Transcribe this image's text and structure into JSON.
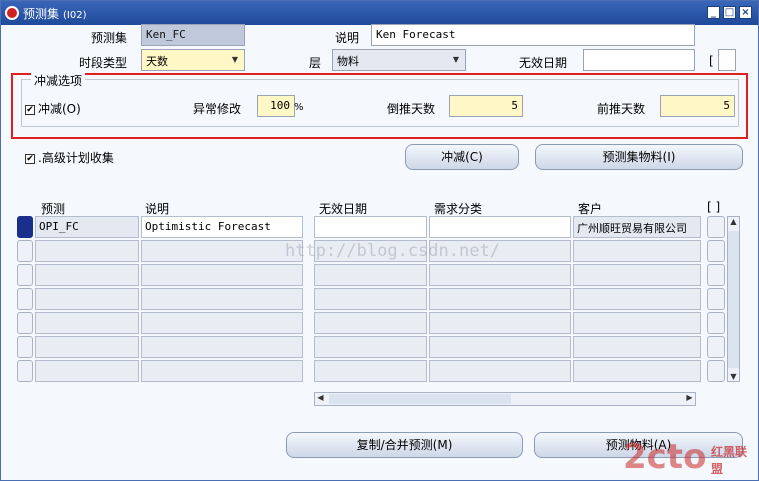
{
  "window": {
    "title": "预测集",
    "code": "(I02)"
  },
  "form": {
    "forecast_set_label": "预测集",
    "forecast_set_value": "Ken_FC",
    "description_label": "说明",
    "description_value": "Ken Forecast",
    "period_type_label": "时段类型",
    "period_type_value": "天数",
    "level_label": "层",
    "level_value": "物料",
    "disable_date_label": "无效日期",
    "disable_date_value": "",
    "bracket_label": "[ ]"
  },
  "consume_group": {
    "title": "冲减选项",
    "consume_label": "冲减(O)",
    "consume_checked": "✔",
    "outlier_label": "异常修改",
    "outlier_value": "100",
    "outlier_unit": "%",
    "backward_label": "倒推天数",
    "backward_value": "5",
    "forward_label": "前推天数",
    "forward_value": "5"
  },
  "advanced": {
    "label": ".高级计划收集",
    "checked": "✔"
  },
  "buttons": {
    "consume": "冲减(C)",
    "forecast_items": "预测集物料(I)",
    "copy_merge": "复制/合并预测(M)",
    "forecast": "预测物料(A)"
  },
  "table": {
    "headers": [
      "预测",
      "说明",
      "无效日期",
      "需求分类",
      "客户",
      "[ ]"
    ],
    "rows": [
      [
        "OPI_FC",
        "Optimistic Forecast",
        "",
        "",
        "广州顺旺贸易有限公司"
      ],
      [
        "",
        "",
        "",
        "",
        ""
      ],
      [
        "",
        "",
        "",
        "",
        ""
      ],
      [
        "",
        "",
        "",
        "",
        ""
      ],
      [
        "",
        "",
        "",
        "",
        ""
      ],
      [
        "",
        "",
        "",
        "",
        ""
      ],
      [
        "",
        "",
        "",
        "",
        ""
      ]
    ]
  },
  "watermark": "http://blog.csdn.net/",
  "logo": {
    "main": "2cto",
    "sub": "红黑联盟"
  },
  "icons": {
    "minimize": "minimize-icon",
    "maximize": "maximize-icon",
    "close": "close-icon",
    "dropdown": "chevron-down-icon"
  }
}
